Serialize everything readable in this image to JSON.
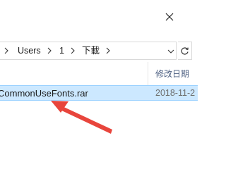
{
  "window": {
    "close_icon": "close-icon"
  },
  "address_bar": {
    "crumbs": [
      "Users",
      "1",
      "下載"
    ],
    "separator_icon": "chevron-right-icon",
    "dropdown_icon": "chevron-down-icon",
    "refresh_icon": "refresh-icon"
  },
  "columns": {
    "date_modified": "修改日期"
  },
  "files": [
    {
      "name": "CommonUseFonts.rar",
      "date": "2018-11-2"
    }
  ],
  "annotation": {
    "arrow_color": "#e8453c"
  }
}
